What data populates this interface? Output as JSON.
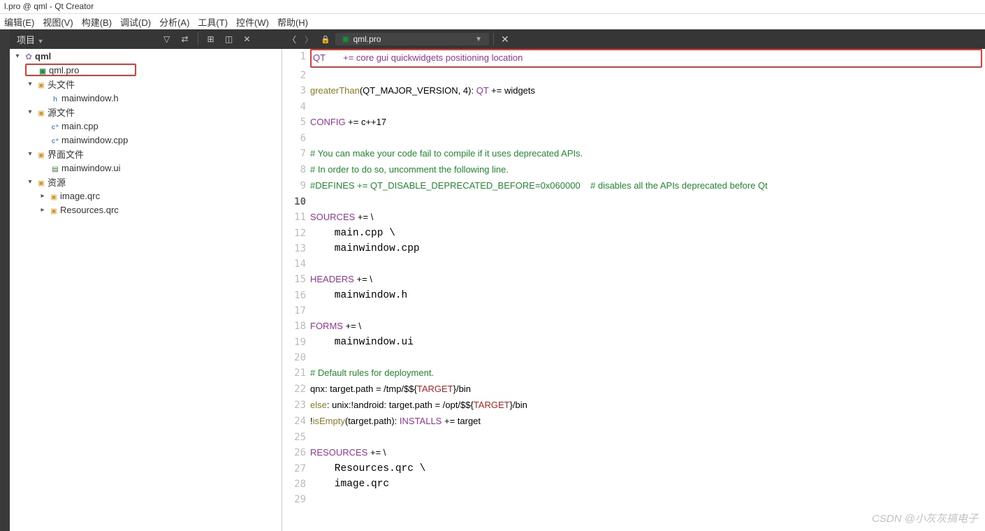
{
  "window": {
    "title": "l.pro @ qml - Qt Creator"
  },
  "menu": {
    "edit": "编辑(E)",
    "view": "视图(V)",
    "build": "构建(B)",
    "debug": "调试(D)",
    "analyze": "分析(A)",
    "tools": "工具(T)",
    "widgets": "控件(W)",
    "help": "帮助(H)"
  },
  "sidebar": {
    "header": "项目",
    "root": "qml",
    "file_selected": "qml.pro",
    "headers_label": "头文件",
    "headers": [
      "mainwindow.h"
    ],
    "sources_label": "源文件",
    "sources": [
      "main.cpp",
      "mainwindow.cpp"
    ],
    "forms_label": "界面文件",
    "forms": [
      "mainwindow.ui"
    ],
    "resources_label": "资源",
    "resources": [
      "image.qrc",
      "Resources.qrc"
    ]
  },
  "tab": {
    "filename": "qml.pro"
  },
  "code": {
    "l1": "QT       += core gui quickwidgets positioning location",
    "l3a": "greaterThan",
    "l3b": "(QT_MAJOR_VERSION, 4): ",
    "l3c": "QT",
    "l3d": " += widgets",
    "l5a": "CONFIG",
    "l5b": " += c++17",
    "l7": "# You can make your code fail to compile if it uses deprecated APIs.",
    "l8": "# In order to do so, uncomment the following line.",
    "l9": "#DEFINES += QT_DISABLE_DEPRECATED_BEFORE=0x060000    # disables all the APIs deprecated before Qt",
    "l11a": "SOURCES",
    "l11b": " += \\",
    "l12": "    main.cpp \\",
    "l13": "    mainwindow.cpp",
    "l15a": "HEADERS",
    "l15b": " += \\",
    "l16": "    mainwindow.h",
    "l18a": "FORMS",
    "l18b": " += \\",
    "l19": "    mainwindow.ui",
    "l21": "# Default rules for deployment.",
    "l22a": "qnx: target.path = /tmp/$${",
    "l22b": "TARGET",
    "l22c": "}/bin",
    "l23a": "else",
    "l23b": ": unix:!android: target.path = /opt/$${",
    "l23c": "TARGET",
    "l23d": "}/bin",
    "l24a": "!",
    "l24b": "isEmpty",
    "l24c": "(target.path): ",
    "l24d": "INSTALLS",
    "l24e": " += target",
    "l26a": "RESOURCES",
    "l26b": " += \\",
    "l27": "    Resources.qrc \\",
    "l28": "    image.qrc"
  },
  "watermark": "CSDN @小灰灰搞电子"
}
